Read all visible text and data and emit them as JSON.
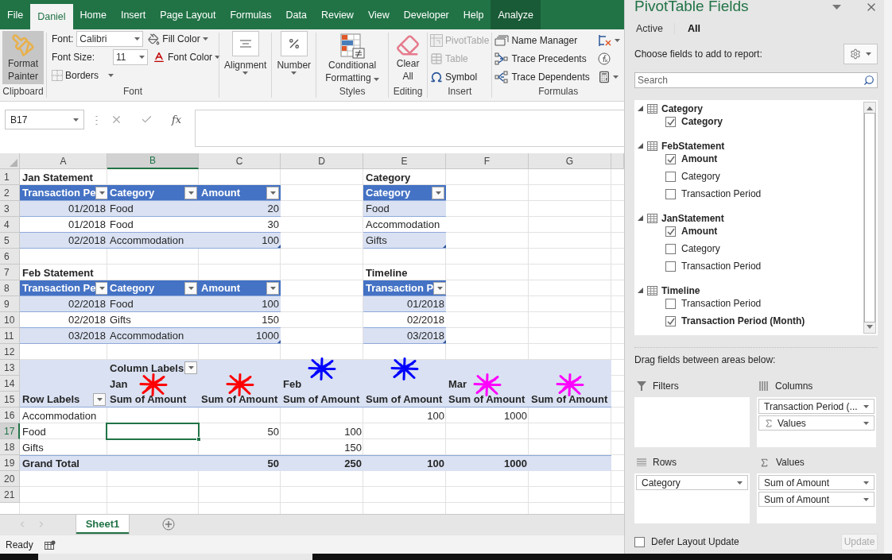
{
  "ribbon": {
    "tabs": [
      {
        "label": "File",
        "selected": false,
        "kind": "normal"
      },
      {
        "label": "Daniel",
        "selected": true,
        "kind": "normal"
      },
      {
        "label": "Home",
        "selected": false,
        "kind": "normal"
      },
      {
        "label": "Insert",
        "selected": false,
        "kind": "normal"
      },
      {
        "label": "Page Layout",
        "selected": false,
        "kind": "normal"
      },
      {
        "label": "Formulas",
        "selected": false,
        "kind": "normal"
      },
      {
        "label": "Data",
        "selected": false,
        "kind": "normal"
      },
      {
        "label": "Review",
        "selected": false,
        "kind": "normal"
      },
      {
        "label": "View",
        "selected": false,
        "kind": "normal"
      },
      {
        "label": "Developer",
        "selected": false,
        "kind": "normal"
      },
      {
        "label": "Help",
        "selected": false,
        "kind": "normal"
      },
      {
        "label": "Analyze",
        "selected": false,
        "kind": "contextual"
      }
    ],
    "clipboard": {
      "label": "Clipboard",
      "button": "Format Painter",
      "pressed": true
    },
    "font": {
      "label": "Font",
      "font_label": "Font:",
      "font_value": "Calibri",
      "size_label": "Font Size:",
      "size_value": "11",
      "fill_color": "Fill Color",
      "font_color": "Font Color",
      "borders": "Borders"
    },
    "alignment": "Alignment",
    "number": "Number",
    "styles": {
      "label": "Styles",
      "button": "Conditional Formatting"
    },
    "editing": {
      "label": "Editing",
      "button": "Clear All"
    },
    "insert": {
      "label": "Insert",
      "items": [
        {
          "label": "PivotTable",
          "disabled": true,
          "kind": "pivot"
        },
        {
          "label": "Table",
          "disabled": true,
          "kind": "table"
        },
        {
          "label": "Symbol",
          "disabled": false,
          "kind": "symbol"
        }
      ]
    },
    "formulas": {
      "label": "Formulas",
      "items": [
        {
          "label": "Name Manager",
          "kind": "names"
        },
        {
          "label": "Trace Precedents",
          "kind": "precedents"
        },
        {
          "label": "Trace Dependents",
          "kind": "dependents"
        }
      ]
    }
  },
  "formula_bar": {
    "name_box": "B17",
    "function_label": "fx"
  },
  "sheet": {
    "columns": [
      {
        "label": "A",
        "selected": false
      },
      {
        "label": "B",
        "selected": true
      },
      {
        "label": "C",
        "selected": false
      },
      {
        "label": "D",
        "selected": false
      },
      {
        "label": "E",
        "selected": false
      },
      {
        "label": "F",
        "selected": false
      },
      {
        "label": "G",
        "selected": false
      }
    ],
    "rows": [
      {
        "number": "1",
        "selected": false,
        "kind": "plain",
        "cells": [
          {
            "kind": "title",
            "text": "Jan Statement"
          },
          null,
          null,
          null,
          {
            "kind": "title",
            "text": "Category"
          }
        ]
      },
      {
        "number": "2",
        "selected": false,
        "kind": "plain",
        "cells": [
          {
            "kind": "header",
            "text": "Transaction Pe",
            "filter": true
          },
          {
            "kind": "header",
            "text": "Category",
            "filter": true
          },
          {
            "kind": "header",
            "text": "Amount",
            "filter": true
          },
          null,
          {
            "kind": "header",
            "text": "Category",
            "filter": true
          }
        ]
      },
      {
        "number": "3",
        "selected": false,
        "kind": "table-band",
        "cells": [
          {
            "kind": "table-number",
            "text": "01/2018"
          },
          {
            "kind": "table-text",
            "text": "Food"
          },
          {
            "kind": "table-number",
            "text": "20"
          },
          null,
          {
            "kind": "table-text",
            "text": "Food"
          }
        ]
      },
      {
        "number": "4",
        "selected": false,
        "kind": "plain",
        "cells": [
          {
            "kind": "table-number",
            "text": "01/2018"
          },
          {
            "kind": "table-text",
            "text": "Food"
          },
          {
            "kind": "table-number",
            "text": "30"
          },
          null,
          {
            "kind": "table-text",
            "text": "Accommodation"
          }
        ]
      },
      {
        "number": "5",
        "selected": false,
        "kind": "table-band",
        "cells": [
          {
            "kind": "table-number",
            "text": "02/2018"
          },
          {
            "kind": "table-text",
            "text": "Accommodation"
          },
          {
            "kind": "table-number",
            "text": "100",
            "corner": true
          },
          null,
          {
            "kind": "table-text",
            "text": "Gifts",
            "corner": true
          }
        ]
      },
      {
        "number": "6",
        "selected": false,
        "kind": "plain"
      },
      {
        "number": "7",
        "selected": false,
        "kind": "plain",
        "cells": [
          {
            "kind": "title",
            "text": "Feb Statement"
          },
          null,
          null,
          null,
          {
            "kind": "title",
            "text": "Timeline"
          }
        ]
      },
      {
        "number": "8",
        "selected": false,
        "kind": "plain",
        "cells": [
          {
            "kind": "header",
            "text": "Transaction Pe",
            "filter": true
          },
          {
            "kind": "header",
            "text": "Category",
            "filter": true
          },
          {
            "kind": "header",
            "text": "Amount",
            "filter": true
          },
          null,
          {
            "kind": "header",
            "text": "Transaction P",
            "filter": true
          }
        ]
      },
      {
        "number": "9",
        "selected": false,
        "kind": "table-band",
        "cells": [
          {
            "kind": "table-number",
            "text": "02/2018"
          },
          {
            "kind": "table-text",
            "text": "Food"
          },
          {
            "kind": "table-number",
            "text": "100"
          },
          null,
          {
            "kind": "table-number",
            "text": "01/2018"
          }
        ]
      },
      {
        "number": "10",
        "selected": false,
        "kind": "plain",
        "cells": [
          {
            "kind": "table-number",
            "text": "02/2018"
          },
          {
            "kind": "table-text",
            "text": "Gifts"
          },
          {
            "kind": "table-number",
            "text": "150"
          },
          null,
          {
            "kind": "table-number",
            "text": "02/2018"
          }
        ]
      },
      {
        "number": "11",
        "selected": false,
        "kind": "table-band",
        "cells": [
          {
            "kind": "table-number",
            "text": "03/2018"
          },
          {
            "kind": "table-text",
            "text": "Accommodation"
          },
          {
            "kind": "table-number",
            "text": "1000",
            "corner": true
          },
          null,
          {
            "kind": "table-number",
            "text": "03/2018",
            "corner": true
          }
        ]
      },
      {
        "number": "12",
        "selected": false,
        "kind": "plain"
      },
      {
        "number": "13",
        "selected": false,
        "kind": "pivot",
        "cells": [
          null,
          {
            "kind": "pivot-head",
            "text": "Column Labels",
            "filter": true
          },
          null,
          {
            "kind": "pivot-head",
            "color": "#0000ff"
          },
          {
            "kind": "pivot-head",
            "color": "#0000ff"
          }
        ]
      },
      {
        "number": "14",
        "selected": false,
        "kind": "pivot",
        "cells": [
          null,
          {
            "kind": "pivot-head",
            "text": "Jan",
            "color": "#ff0000"
          },
          {
            "kind": "pivot-head",
            "color": "#ff0000"
          },
          {
            "kind": "pivot-head",
            "text": "Feb"
          },
          null,
          {
            "kind": "pivot-head",
            "text": "Mar",
            "color": "#ff00ff"
          },
          {
            "kind": "pivot-head",
            "color": "#ff00ff"
          }
        ]
      },
      {
        "number": "15",
        "selected": false,
        "kind": "pivot-edge",
        "cells": [
          {
            "kind": "pivot-head",
            "text": "Row Labels",
            "filter": true
          },
          {
            "kind": "pivot-head",
            "text": "Sum of Amount"
          },
          {
            "kind": "pivot-head",
            "text": "Sum of Amount"
          },
          {
            "kind": "pivot-head",
            "text": "Sum of Amount"
          },
          {
            "kind": "pivot-head",
            "text": "Sum of Amount"
          },
          {
            "kind": "pivot-head",
            "text": "Sum of Amount"
          },
          {
            "kind": "pivot-head",
            "text": "Sum of Amount"
          }
        ]
      },
      {
        "number": "16",
        "selected": false,
        "kind": "plain",
        "cells": [
          {
            "kind": "pivot-text",
            "text": "Accommodation"
          },
          null,
          null,
          null,
          {
            "kind": "pivot-number",
            "text": "100"
          },
          {
            "kind": "pivot-number",
            "text": "1000"
          }
        ]
      },
      {
        "number": "17",
        "selected": true,
        "kind": "plain",
        "cells": [
          {
            "kind": "pivot-text",
            "text": "Food"
          },
          null,
          {
            "kind": "pivot-number",
            "text": "50"
          },
          {
            "kind": "pivot-number",
            "text": "100"
          }
        ]
      },
      {
        "number": "18",
        "selected": false,
        "kind": "plain",
        "cells": [
          {
            "kind": "pivot-text",
            "text": "Gifts"
          },
          null,
          null,
          {
            "kind": "pivot-number",
            "text": "150"
          }
        ]
      },
      {
        "number": "19",
        "selected": false,
        "kind": "pivot-total",
        "cells": [
          {
            "kind": "total-text",
            "text": "Grand Total"
          },
          null,
          {
            "kind": "total-number",
            "text": "50"
          },
          {
            "kind": "total-number",
            "text": "250"
          },
          {
            "kind": "total-number",
            "text": "100"
          },
          {
            "kind": "total-number",
            "text": "1000"
          }
        ]
      },
      {
        "number": "20",
        "selected": false,
        "kind": "plain"
      },
      {
        "number": "21",
        "selected": false,
        "kind": "plain"
      }
    ]
  },
  "sheet_tabs": [
    {
      "label": "Sheet1",
      "selected": true
    }
  ],
  "status_bar": {
    "text": "Ready"
  },
  "pivot_panel": {
    "title": "PivotTable Fields",
    "tabs": [
      {
        "label": "Active",
        "selected": false
      },
      {
        "label": "All",
        "selected": true
      }
    ],
    "prompt": "Choose fields to add to report:",
    "search": {
      "placeholder": "Search"
    },
    "tables": [
      {
        "name": "Category",
        "expanded": true,
        "children": [
          {
            "name": "Category",
            "checked": true
          }
        ]
      },
      {
        "name": "FebStatement",
        "expanded": true,
        "children": [
          {
            "name": "Amount",
            "checked": true
          },
          {
            "name": "Category",
            "checked": false
          },
          {
            "name": "Transaction Period",
            "checked": false
          }
        ]
      },
      {
        "name": "JanStatement",
        "expanded": true,
        "children": [
          {
            "name": "Amount",
            "checked": true
          },
          {
            "name": "Category",
            "checked": false
          },
          {
            "name": "Transaction Period",
            "checked": false
          }
        ]
      },
      {
        "name": "Timeline",
        "expanded": true,
        "children": [
          {
            "name": "Transaction Period",
            "checked": false
          },
          {
            "name": "Transaction Period (Month)",
            "checked": true
          }
        ]
      }
    ],
    "areas_prompt": "Drag fields between areas below:",
    "areas": [
      {
        "kind": "filters",
        "label": "Filters"
      },
      {
        "kind": "columns",
        "label": "Columns",
        "items": [
          {
            "label": "Transaction Period (...",
            "kind": "field"
          },
          {
            "label": "Values",
            "kind": "values"
          }
        ]
      },
      {
        "kind": "rows",
        "label": "Rows",
        "items": [
          {
            "label": "Category",
            "kind": "field"
          }
        ]
      },
      {
        "kind": "values",
        "label": "Values",
        "items": [
          {
            "label": "Sum of Amount",
            "kind": "field"
          },
          {
            "label": "Sum of Amount",
            "kind": "field"
          }
        ]
      }
    ],
    "defer": {
      "label": "Defer Layout Update",
      "checked": false
    },
    "update": {
      "label": "Update",
      "disabled": true
    }
  }
}
